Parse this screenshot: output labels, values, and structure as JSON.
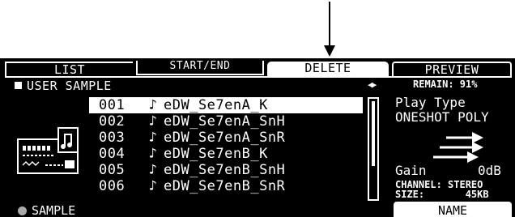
{
  "tabs": [
    {
      "label": "LIST"
    },
    {
      "label": "START/END"
    },
    {
      "label": "DELETE"
    },
    {
      "label": "PREVIEW"
    }
  ],
  "header": {
    "title": "USER SAMPLE",
    "remain": "REMAIN: 91%"
  },
  "samples": [
    {
      "num": "001",
      "name": "eDW_Se7enA_K",
      "selected": true
    },
    {
      "num": "002",
      "name": "eDW_Se7enA_SnH",
      "selected": false
    },
    {
      "num": "003",
      "name": "eDW_Se7enA_SnR",
      "selected": false
    },
    {
      "num": "004",
      "name": "eDW_Se7enB_K",
      "selected": false
    },
    {
      "num": "005",
      "name": "eDW_Se7enB_SnH",
      "selected": false
    },
    {
      "num": "006",
      "name": "eDW_Se7enB_SnR",
      "selected": false
    }
  ],
  "info": {
    "play_type_label": "Play Type",
    "play_type_value": "ONESHOT POLY",
    "gain_label": "Gain",
    "gain_value": "0dB",
    "channel": "CHANNEL: STEREO",
    "size": "SIZE:       45KB"
  },
  "footer": {
    "sample_label": "SAMPLE",
    "name_button": "NAME"
  },
  "colors": {
    "screen_bg": "#000000",
    "text": "#ffffff",
    "highlight": "#ffffff"
  }
}
